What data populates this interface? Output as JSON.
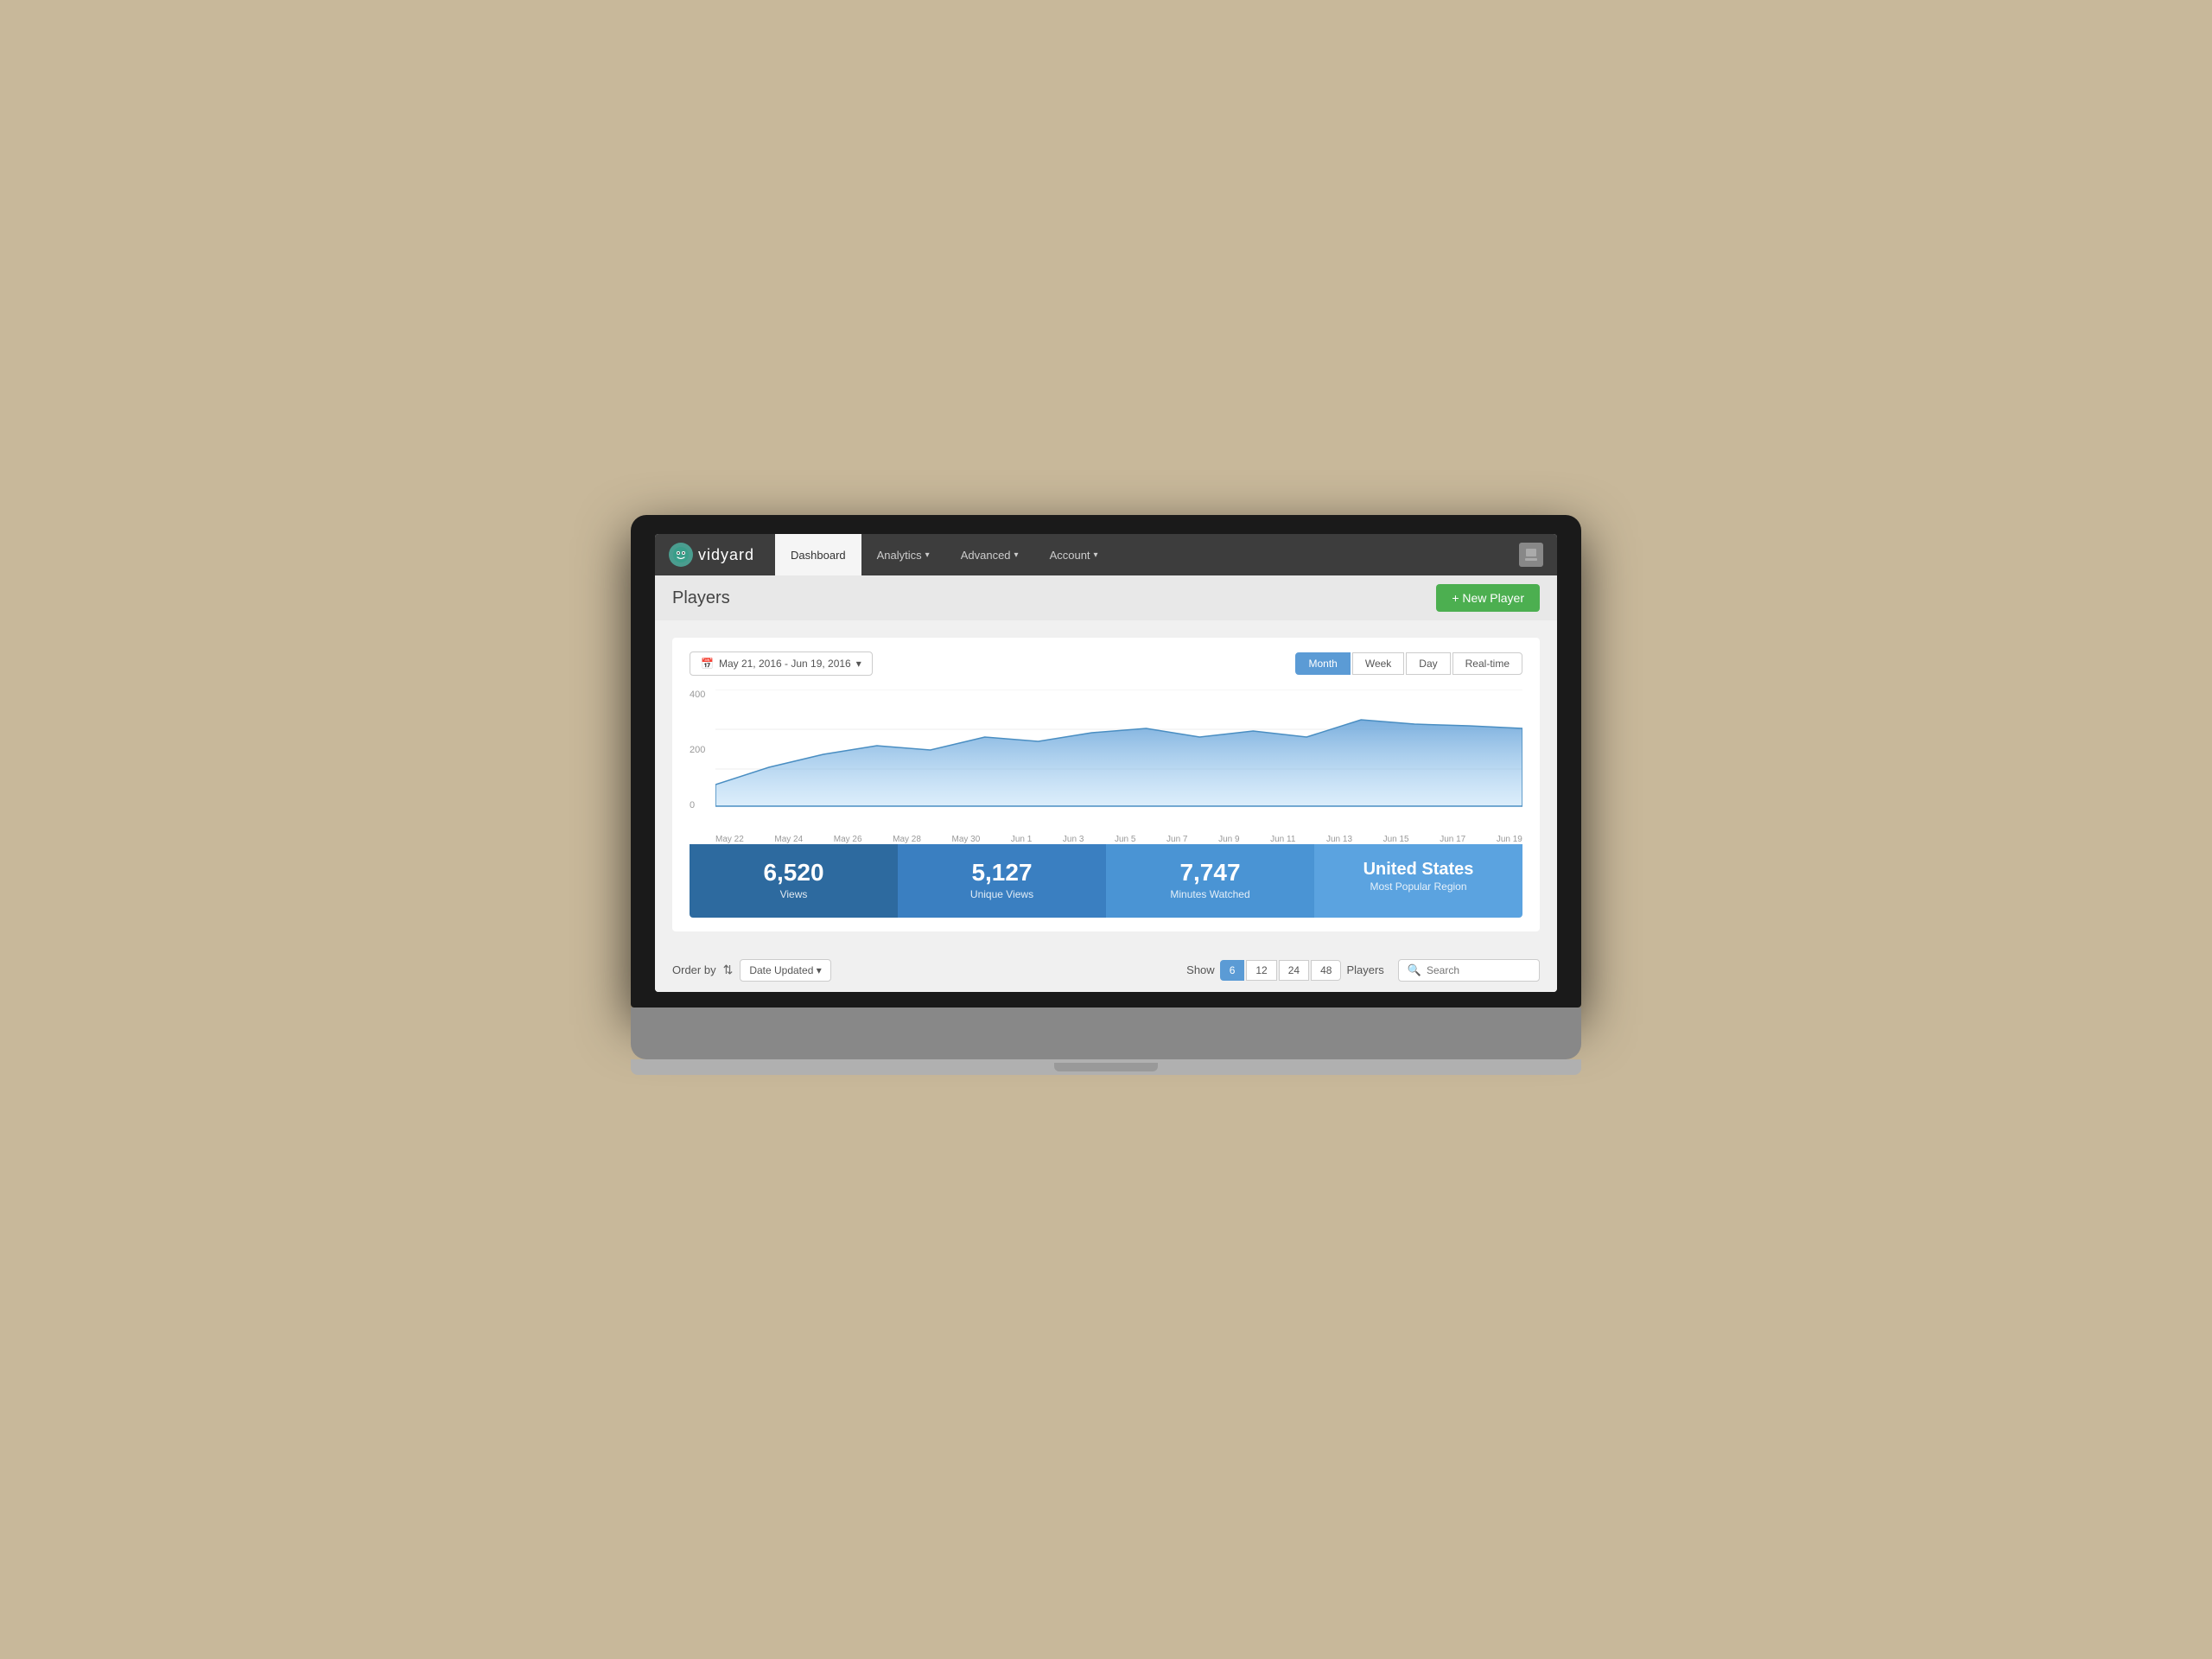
{
  "logo": {
    "icon": "▶",
    "text": "vidyard"
  },
  "nav": {
    "tabs": [
      {
        "label": "Dashboard",
        "active": true
      },
      {
        "label": "Analytics",
        "hasArrow": true
      },
      {
        "label": "Advanced",
        "hasArrow": true
      },
      {
        "label": "Account",
        "hasArrow": true
      }
    ]
  },
  "page": {
    "title": "Players",
    "new_player_btn": "+ New Player"
  },
  "chart": {
    "date_range": "May 21, 2016 - Jun 19, 2016",
    "time_buttons": [
      "Month",
      "Week",
      "Day",
      "Real-time"
    ],
    "active_time": "Month",
    "y_labels": [
      "400",
      "200",
      "0"
    ],
    "x_labels": [
      "May 22",
      "May 24",
      "May 26",
      "May 28",
      "May 30",
      "Jun 1",
      "Jun 3",
      "Jun 5",
      "Jun 7",
      "Jun 9",
      "Jun 11",
      "Jun 13",
      "Jun 15",
      "Jun 17",
      "Jun 19"
    ]
  },
  "stats": [
    {
      "number": "6,520",
      "label": "Views"
    },
    {
      "number": "5,127",
      "label": "Unique Views"
    },
    {
      "number": "7,747",
      "label": "Minutes Watched"
    },
    {
      "number": "United States",
      "label": "Most Popular Region"
    }
  ],
  "bottom": {
    "order_by_label": "Order by",
    "date_updated": "Date Updated",
    "show_label": "Show",
    "show_options": [
      "6",
      "12",
      "24",
      "48"
    ],
    "players_label": "Players",
    "search_placeholder": "Search"
  }
}
